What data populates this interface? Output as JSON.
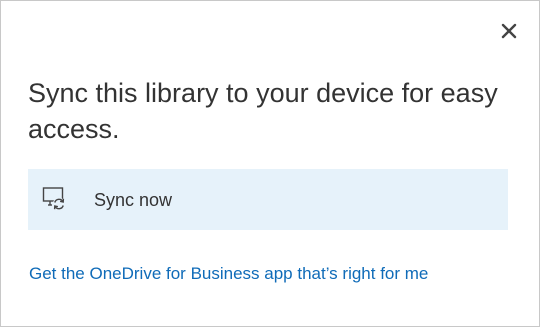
{
  "dialog": {
    "close_icon": "close-icon",
    "heading": "Sync this library to your device for easy access.",
    "sync_option": {
      "icon": "sync-device-icon",
      "label": "Sync now",
      "background": "#e6f2fa"
    },
    "app_link": {
      "label": "Get the OneDrive for Business app that’s right for me",
      "color": "#0f6bb8"
    }
  }
}
